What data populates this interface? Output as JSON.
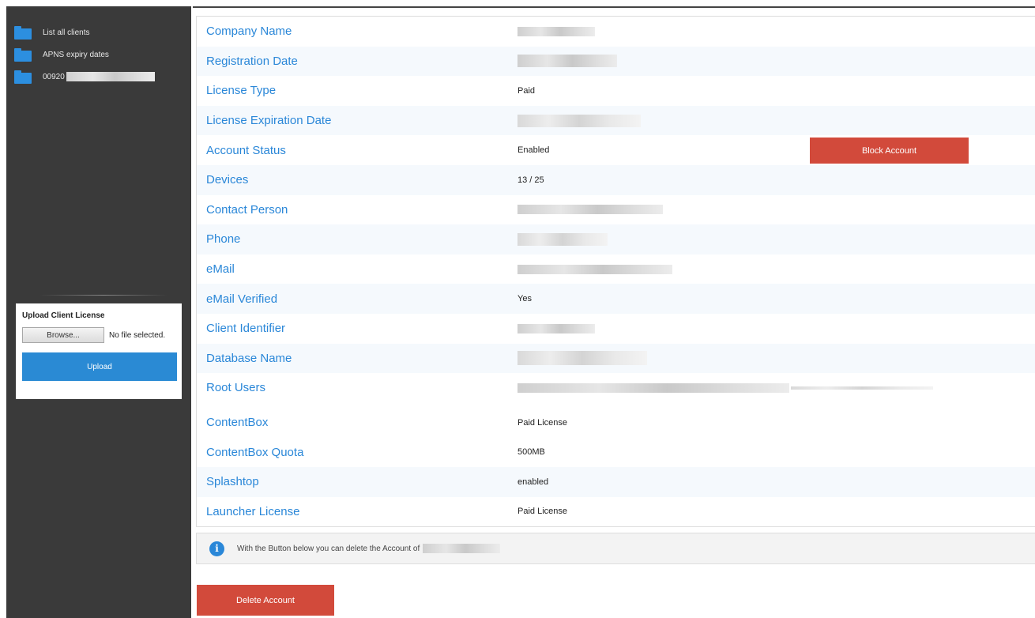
{
  "sidebar": {
    "items": [
      {
        "label": "List all clients",
        "icon": "folder-icon"
      },
      {
        "label": "APNS expiry dates",
        "icon": "folder-icon"
      },
      {
        "label": "00920",
        "icon": "folder-icon"
      }
    ],
    "upload": {
      "title": "Upload Client License",
      "browse_label": "Browse...",
      "no_file": "No file selected.",
      "upload_label": "Upload"
    }
  },
  "details": {
    "company_name": {
      "label": "Company Name"
    },
    "registration_date": {
      "label": "Registration Date"
    },
    "license_type": {
      "label": "License Type",
      "value": "Paid"
    },
    "license_expiration": {
      "label": "License Expiration Date"
    },
    "account_status": {
      "label": "Account Status",
      "value": "Enabled",
      "action": "Block Account"
    },
    "devices": {
      "label": "Devices",
      "value": "13 / 25"
    },
    "contact_person": {
      "label": "Contact Person"
    },
    "phone": {
      "label": "Phone"
    },
    "email": {
      "label": "eMail"
    },
    "email_verified": {
      "label": "eMail Verified",
      "value": "Yes"
    },
    "client_identifier": {
      "label": "Client Identifier"
    },
    "database_name": {
      "label": "Database Name"
    },
    "root_users": {
      "label": "Root Users"
    },
    "contentbox": {
      "label": "ContentBox",
      "value": "Paid License"
    },
    "contentbox_quota": {
      "label": "ContentBox Quota",
      "value": "500MB"
    },
    "splashtop": {
      "label": "Splashtop",
      "value": "enabled"
    },
    "launcher_license": {
      "label": "Launcher License",
      "value": "Paid License"
    }
  },
  "info": {
    "icon": "info-icon",
    "text": "With the Button below you can delete the Account of"
  },
  "delete_label": "Delete Account",
  "colors": {
    "sidebar_bg": "#3a3a3a",
    "accent_blue": "#2a87d8",
    "danger_red": "#d24a3b"
  }
}
